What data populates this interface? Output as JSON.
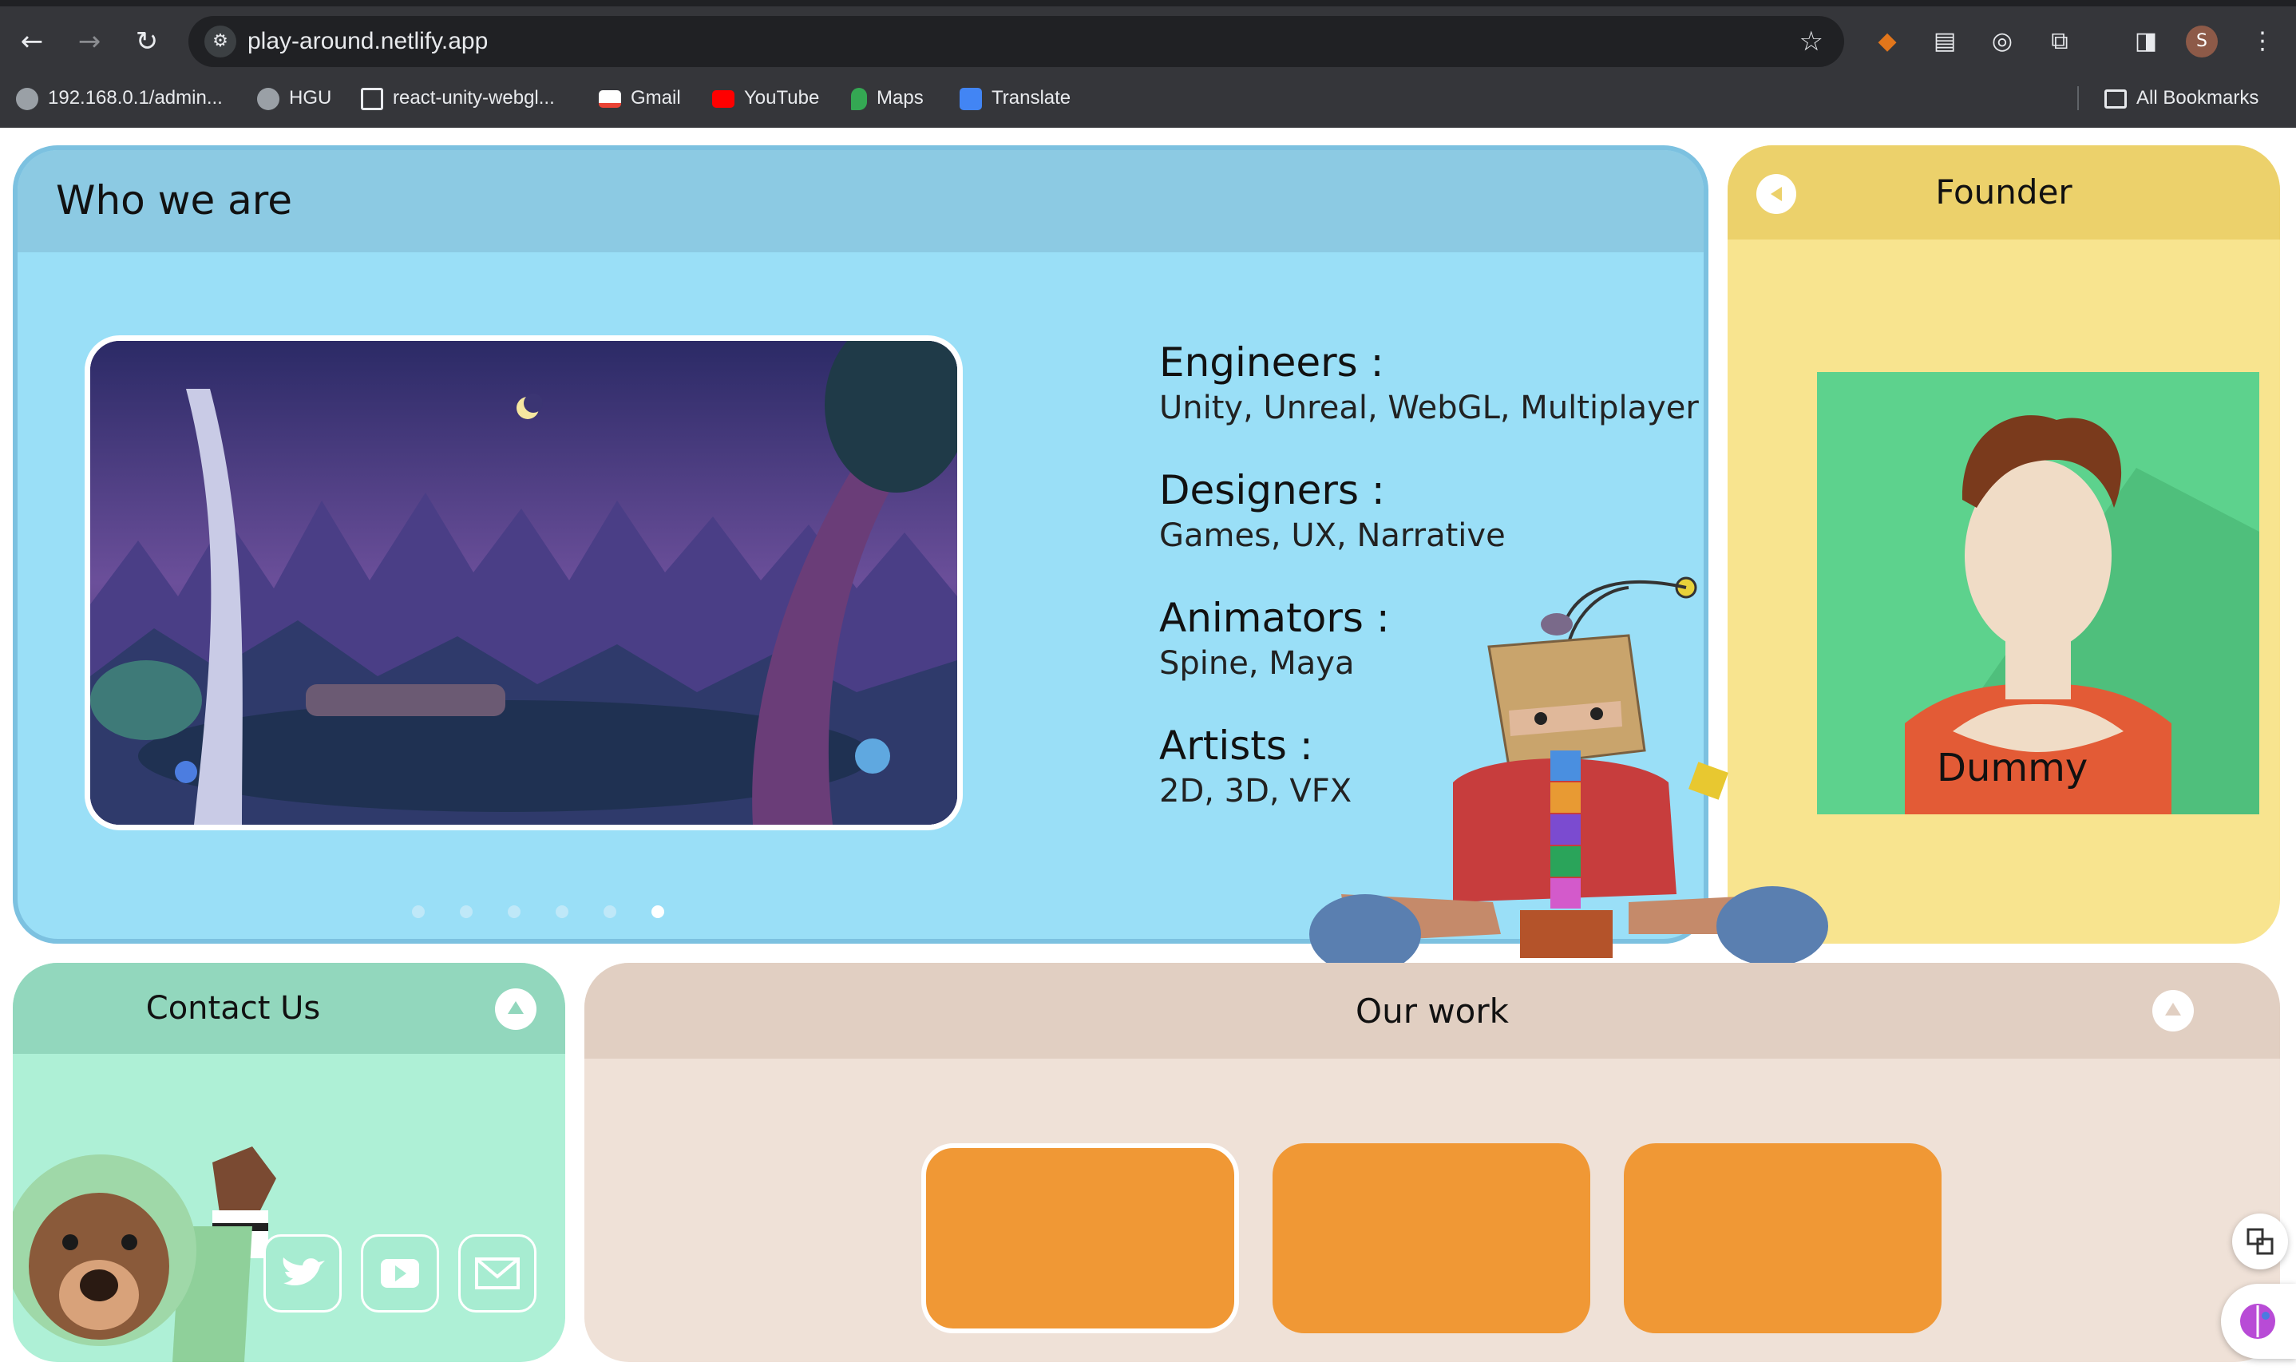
{
  "browser": {
    "url": "play-around.netlify.app",
    "profile_initial": "S",
    "bookmarks": [
      {
        "label": "192.168.0.1/admin...",
        "icon": "globe-icon"
      },
      {
        "label": "HGU",
        "icon": "globe-icon"
      },
      {
        "label": "react-unity-webgl...",
        "icon": "page-icon"
      },
      {
        "label": "Gmail",
        "icon": "gmail-icon"
      },
      {
        "label": "YouTube",
        "icon": "youtube-icon"
      },
      {
        "label": "Maps",
        "icon": "maps-icon"
      },
      {
        "label": "Translate",
        "icon": "translate-icon"
      }
    ],
    "all_bookmarks": "All Bookmarks"
  },
  "who": {
    "title": "Who we are",
    "carousel_dots": 6,
    "active_dot": 6,
    "roles": [
      {
        "heading": "Engineers :",
        "value": "Unity, Unreal, WebGL, Multiplayer"
      },
      {
        "heading": "Designers :",
        "value": "Games, UX, Narrative"
      },
      {
        "heading": "Animators :",
        "value": "Spine, Maya"
      },
      {
        "heading": "Artists :",
        "value": "2D, 3D, VFX"
      }
    ]
  },
  "founder": {
    "title": "Founder",
    "name": "Dummy"
  },
  "contact": {
    "title": "Contact Us",
    "socials": [
      "twitter-icon",
      "youtube-icon",
      "mail-icon"
    ]
  },
  "work": {
    "title": "Our work",
    "cards": 3
  },
  "colors": {
    "who_bg": "#9adff7",
    "founder_bg": "#f8e48f",
    "contact_bg": "#aef0d6",
    "work_bg": "#efe1d7",
    "card": "#f09835"
  }
}
